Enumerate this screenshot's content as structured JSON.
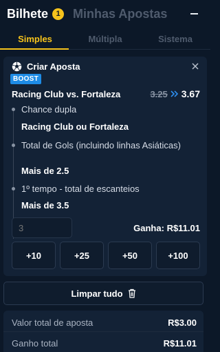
{
  "header": {
    "title": "Bilhete",
    "count": "1",
    "other_title": "Minhas Apostas"
  },
  "tabs": [
    {
      "label": "Simples",
      "active": true
    },
    {
      "label": "Múltipla",
      "active": false
    },
    {
      "label": "Sistema",
      "active": false
    }
  ],
  "bet": {
    "criar_label": "Criar Aposta",
    "boost_label": "BOOST",
    "match": "Racing Club vs. Fortaleza",
    "odds_old": "3.25",
    "odds_new": "3.67",
    "legs": [
      {
        "market": "Chance dupla",
        "selection": "Racing Club ou Fortaleza"
      },
      {
        "market": "Total de Gols (incluindo linhas Asiáticas)",
        "selection": "Mais de 2.5"
      },
      {
        "market": "1º tempo - total de escanteios",
        "selection": "Mais de 3.5"
      }
    ],
    "stake_placeholder": "3",
    "winnings_label": "Ganha:",
    "winnings_value": "R$11.01",
    "quick_amounts": [
      "+10",
      "+25",
      "+50",
      "+100"
    ]
  },
  "clear_label": "Limpar tudo",
  "summary": {
    "total_stake_label": "Valor total de aposta",
    "total_stake_value": "R$3.00",
    "total_win_label": "Ganho total",
    "total_win_value": "R$11.01"
  },
  "colors": {
    "background": "#0c1828",
    "card": "#132236",
    "accent": "#f6c31c",
    "boost": "#1e8ce6"
  }
}
